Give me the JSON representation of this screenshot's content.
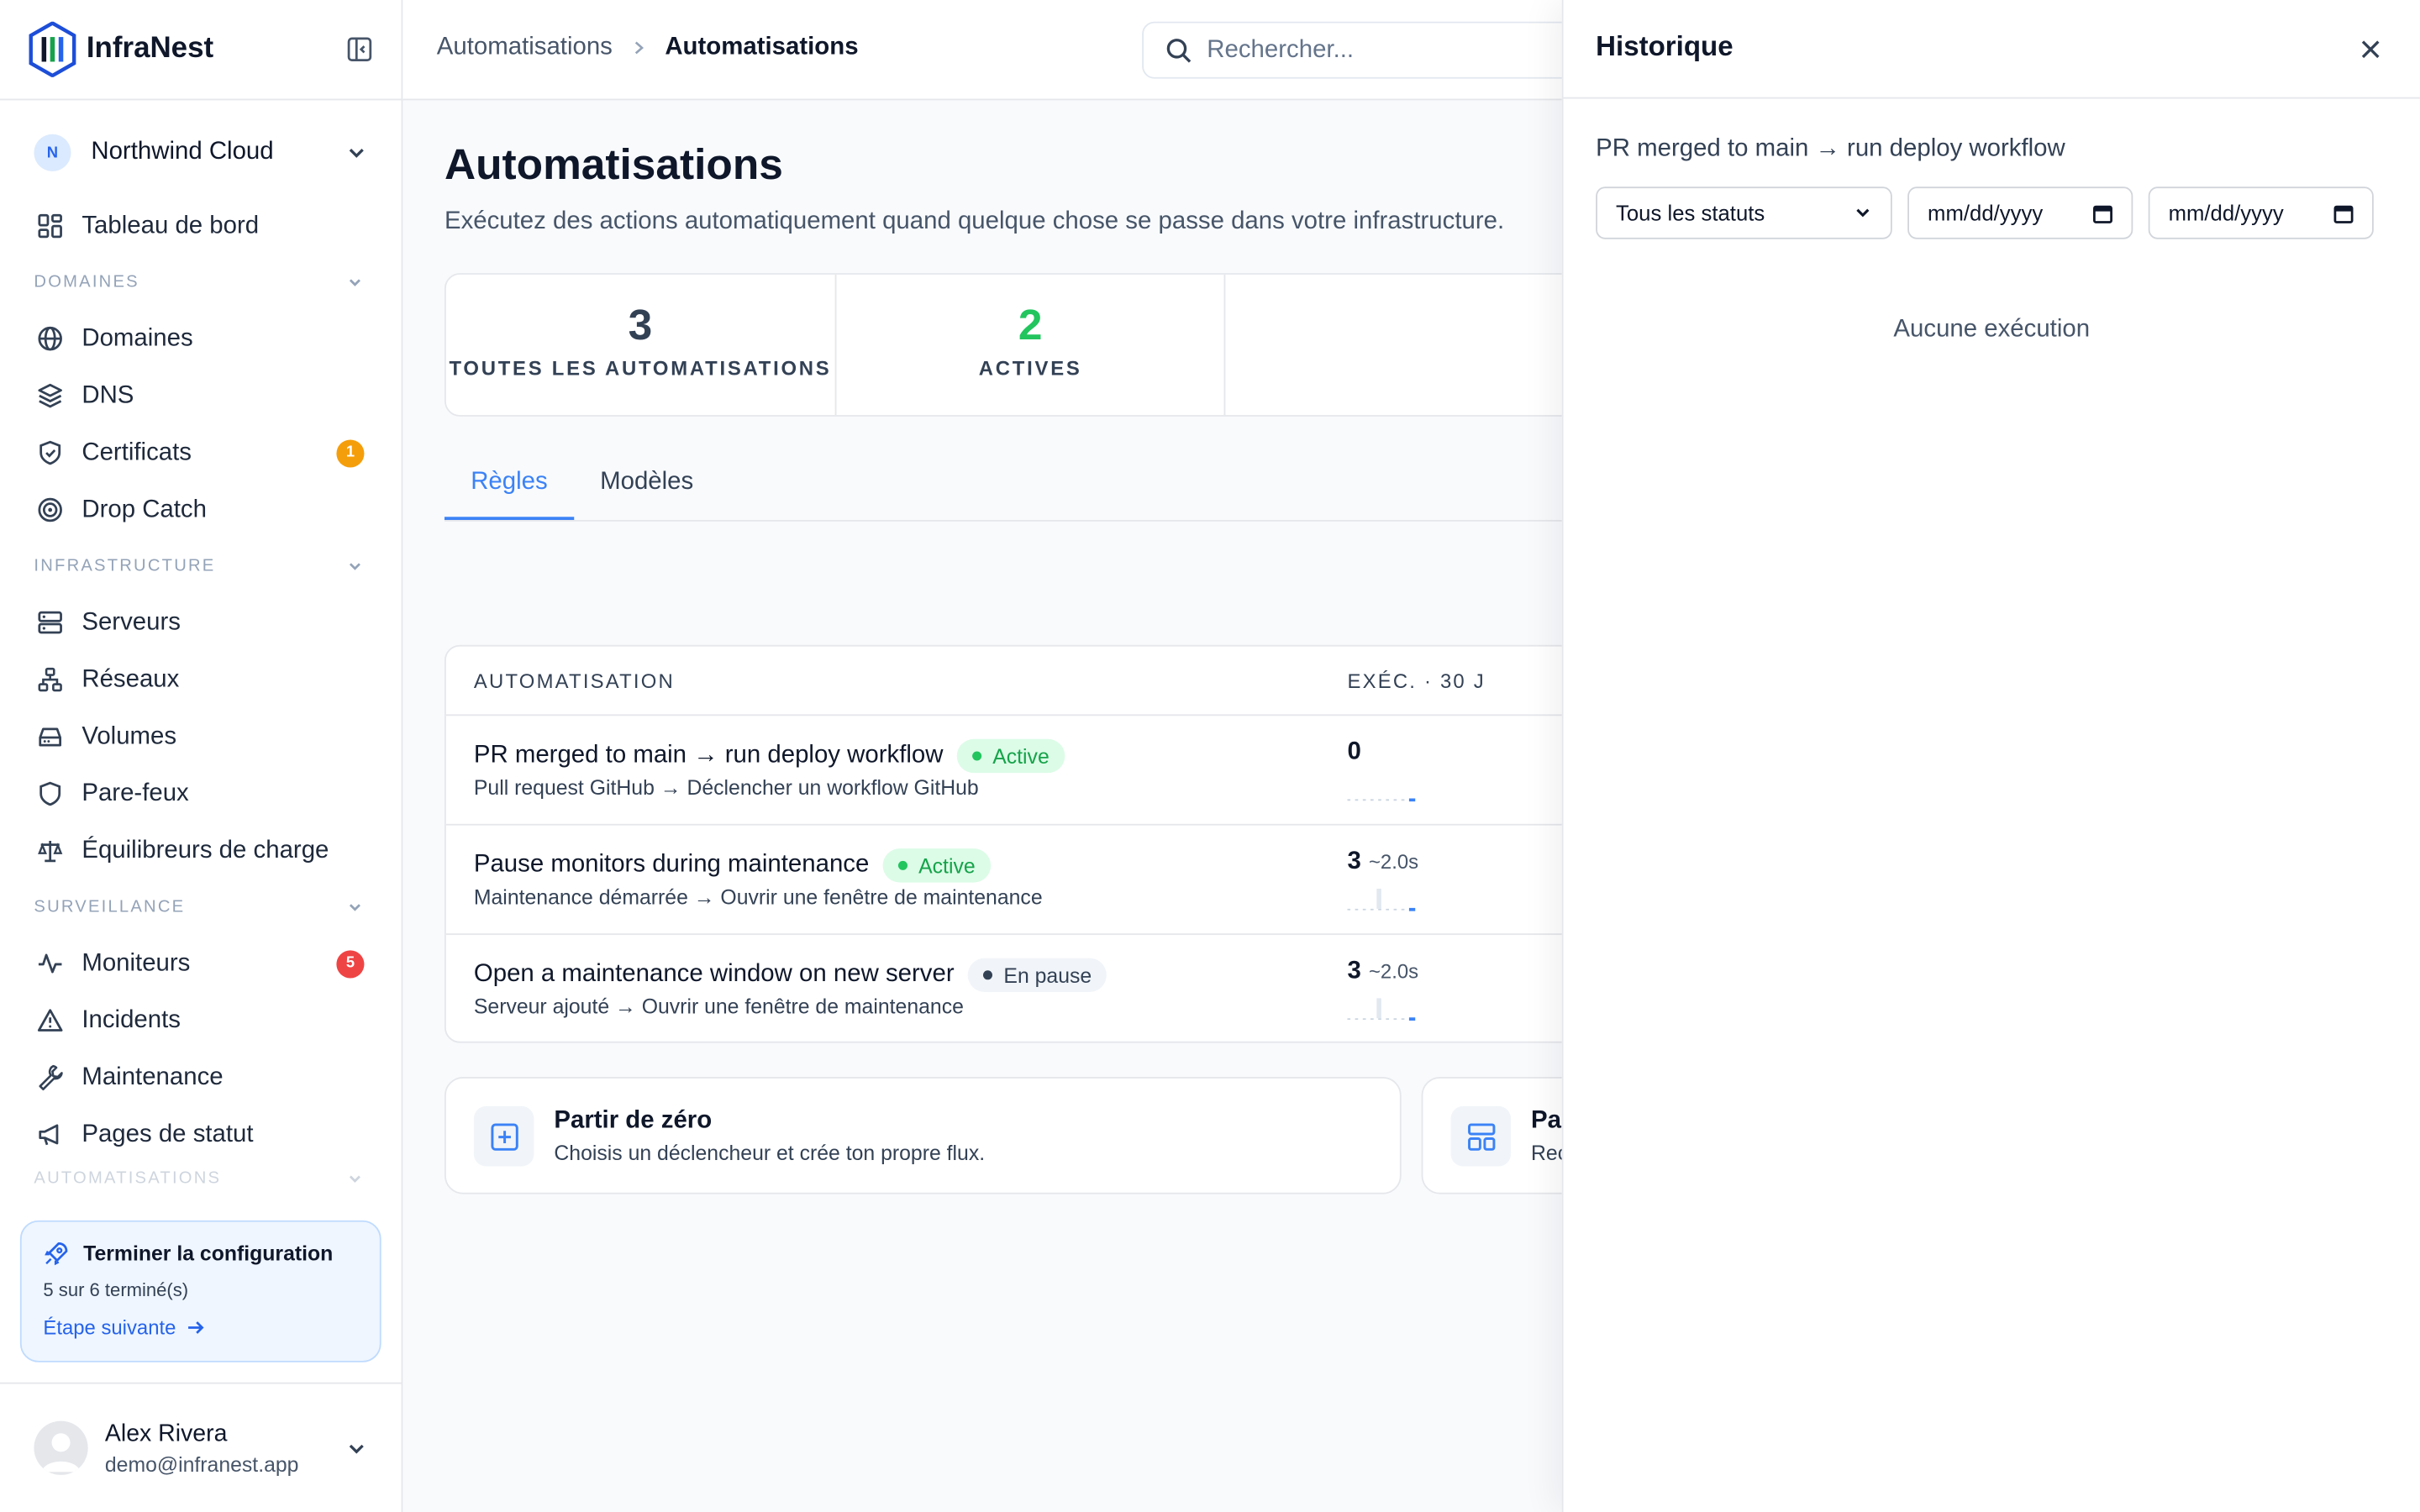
{
  "brand": {
    "name": "InfraNest"
  },
  "org": {
    "initial": "N",
    "name": "Northwind Cloud"
  },
  "nav": {
    "dashboard": "Tableau de bord",
    "sections": {
      "domaines": "DOMAINES",
      "infrastructure": "INFRASTRUCTURE",
      "surveillance": "SURVEILLANCE",
      "automatisations": "AUTOMATISATIONS"
    },
    "items": {
      "domaines": "Domaines",
      "dns": "DNS",
      "certificats": "Certificats",
      "certificats_badge": "1",
      "dropcatch": "Drop Catch",
      "serveurs": "Serveurs",
      "reseaux": "Réseaux",
      "volumes": "Volumes",
      "parefeux": "Pare-feux",
      "equilibreurs": "Équilibreurs de charge",
      "moniteurs": "Moniteurs",
      "moniteurs_badge": "5",
      "incidents": "Incidents",
      "maintenance": "Maintenance",
      "pages_statut": "Pages de statut"
    }
  },
  "setup": {
    "title": "Terminer la configuration",
    "progress": "5 sur 6 terminé(s)",
    "link": "Étape suivante"
  },
  "user": {
    "name": "Alex Rivera",
    "email": "demo@infranest.app"
  },
  "topbar": {
    "crumb_parent": "Automatisations",
    "crumb_current": "Automatisations",
    "search_placeholder": "Rechercher..."
  },
  "main": {
    "title": "Automatisations",
    "subtitle": "Exécutez des actions automatiquement quand quelque chose se passe dans votre infrastructure.",
    "stats": [
      {
        "value": "3",
        "label": "TOUTES LES AUTOMATISATIONS"
      },
      {
        "value": "2",
        "label": "ACTIVES"
      }
    ],
    "tabs": [
      "Règles",
      "Modèles"
    ],
    "table": {
      "col_automation": "AUTOMATISATION",
      "col_runs": "EXÉC. · 30 J",
      "rows": [
        {
          "name": "PR merged to main → run deploy workflow",
          "status": "Active",
          "desc": "Pull request GitHub → Déclencher un workflow GitHub",
          "runs": "0",
          "avg": ""
        },
        {
          "name": "Pause monitors during maintenance",
          "status": "Active",
          "desc": "Maintenance démarrée → Ouvrir une fenêtre de maintenance",
          "runs": "3",
          "avg": "~2.0s"
        },
        {
          "name": "Open a maintenance window on new server",
          "status": "En pause",
          "desc": "Serveur ajouté → Ouvrir une fenêtre de maintenance",
          "runs": "3",
          "avg": "~2.0s"
        }
      ]
    },
    "cards": [
      {
        "title": "Partir de zéro",
        "subtitle": "Choisis un déclencheur et crée ton propre flux."
      },
      {
        "title": "Pa",
        "subtitle": "Rec"
      }
    ]
  },
  "panel": {
    "title": "Historique",
    "subtitle": "PR merged to main → run deploy workflow",
    "status_filter": "Tous les statuts",
    "date_from": "mm/dd/yyyy",
    "date_to": "mm/dd/yyyy",
    "empty": "Aucune exécution"
  },
  "colors": {
    "accent": "#3b82f6",
    "success": "#22c55e",
    "warning": "#f59e0b",
    "danger": "#ef4444"
  }
}
